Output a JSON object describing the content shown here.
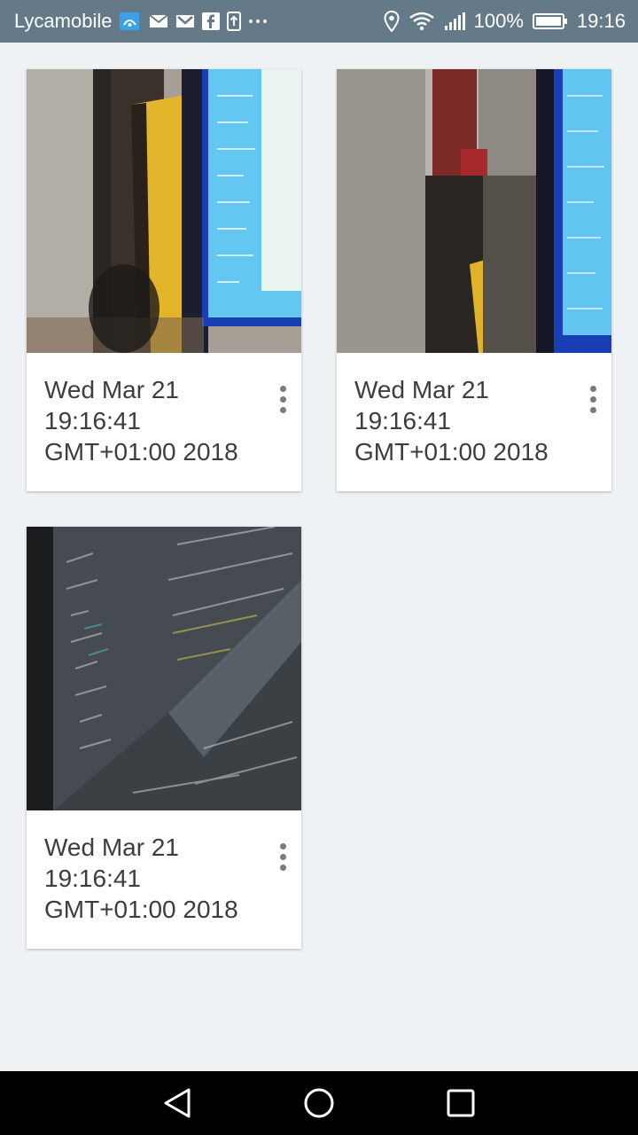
{
  "status_bar": {
    "carrier": "Lycamobile",
    "battery": "100%",
    "time": "19:16",
    "left_icons": [
      "wifi-calling-icon",
      "email-icon",
      "gmail-icon",
      "facebook-icon",
      "upload-icon",
      "more-dots-icon"
    ],
    "right_icons": [
      "location-icon",
      "wifi-icon",
      "signal-icon",
      "battery-icon"
    ]
  },
  "gallery": {
    "items": [
      {
        "caption": "Wed Mar 21 19:16:41 GMT+01:00 2018",
        "image": "photo of monitor and shelf"
      },
      {
        "caption": "Wed Mar 21 19:16:41 GMT+01:00 2018",
        "image": "photo of monitor and shelf"
      },
      {
        "caption": "Wed Mar 21 19:16:41 GMT+01:00 2018",
        "image": "photo of code on screen"
      }
    ]
  },
  "nav_bar": {
    "buttons": [
      "back-button",
      "home-button",
      "recents-button"
    ]
  },
  "colors": {
    "status_bar": "#647a89",
    "background": "#eff2f5",
    "nav_bar": "#000000"
  }
}
